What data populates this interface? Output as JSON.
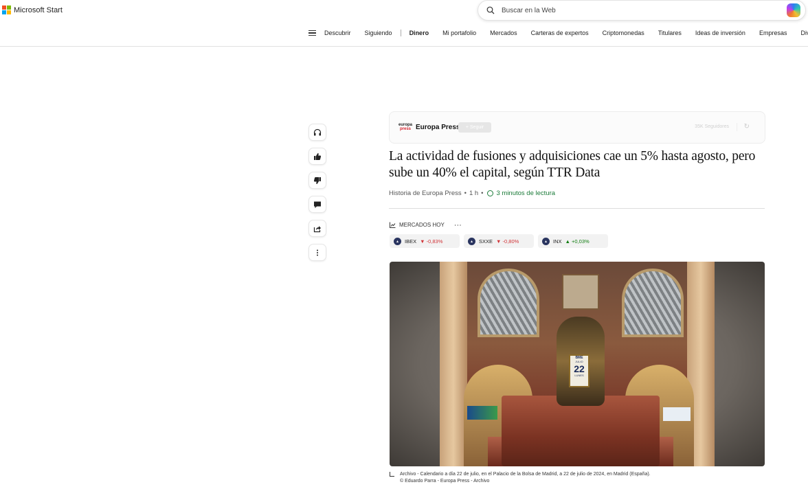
{
  "brand": {
    "name": "Microsoft Start"
  },
  "search": {
    "placeholder": "Buscar en la Web"
  },
  "nav": {
    "items": [
      "Descubrir",
      "Siguiendo",
      "Dinero",
      "Mi portafolio",
      "Mercados",
      "Carteras de expertos",
      "Criptomonedas",
      "Titulares",
      "Ideas de inversión",
      "Empresas",
      "Divisas"
    ],
    "active": "Dinero"
  },
  "side_actions": [
    "headphones-icon",
    "thumbs-up-icon",
    "thumbs-down-icon",
    "comment-icon",
    "share-icon",
    "more-vertical-icon"
  ],
  "publisher": {
    "logo_top": "europa",
    "logo_bottom": "press",
    "name": "Europa Press",
    "follow_label": "+ Seguir",
    "followers": "35K Seguidores"
  },
  "article": {
    "title": "La actividad de fusiones y adquisiciones cae un 5% hasta agosto, pero sube un 40% el capital, según TTR Data",
    "byline": "Historia de Europa Press",
    "age": "1 h",
    "read_time": "3 minutos de lectura"
  },
  "markets": {
    "heading": "MERCADOS HOY",
    "more": "···",
    "tickers": [
      {
        "symbol": "IBEX",
        "arrow": "▼",
        "change": "-0,83%",
        "direction": "down"
      },
      {
        "symbol": "SXXE",
        "arrow": "▼",
        "change": "-0,80%",
        "direction": "down"
      },
      {
        "symbol": "INX",
        "arrow": "▲",
        "change": "+0,03%",
        "direction": "up"
      }
    ]
  },
  "photo": {
    "calendar_brand": "BME",
    "calendar_month": "JULIO",
    "calendar_day": "22",
    "calendar_weekday": "LUNES"
  },
  "caption": {
    "line1": "Archivo - Calendario a día 22 de julio, en el Palacio de la Bolsa de Madrid, a 22 de julio de 2024, en Madrid (España).",
    "line2": "© Eduardo Parra - Europa Press - Archivo"
  },
  "colors": {
    "accent_green": "#1a7a38",
    "down_red": "#d13438",
    "up_green": "#107c10"
  }
}
